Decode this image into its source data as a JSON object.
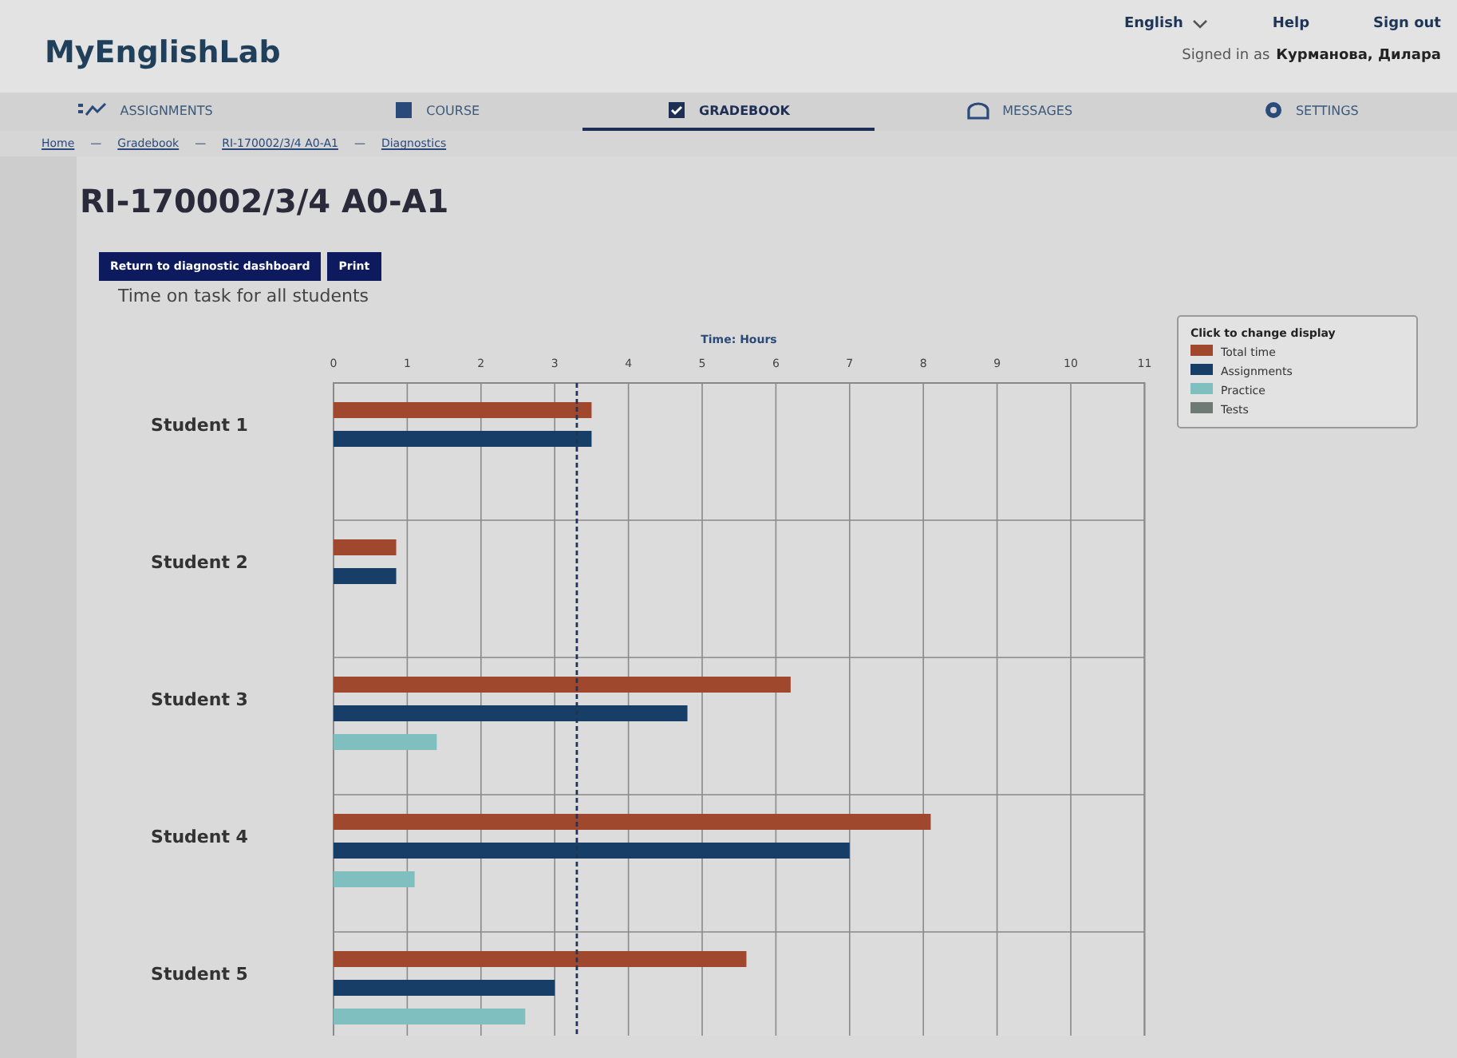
{
  "header": {
    "logo": "MyEnglishLab",
    "language": "English",
    "help": "Help",
    "sign_out": "Sign out",
    "signed_in_label": "Signed in as",
    "user": "Курманова, Дилара"
  },
  "tabs": [
    {
      "label": "ASSIGNMENTS",
      "selected": false
    },
    {
      "label": "COURSE",
      "selected": false
    },
    {
      "label": "GRADEBOOK",
      "selected": true
    },
    {
      "label": "MESSAGES",
      "selected": false
    },
    {
      "label": "SETTINGS",
      "selected": false
    }
  ],
  "breadcrumb": {
    "separator": "—",
    "items": [
      "Home",
      "Gradebook",
      "RI-170002/3/4 A0-A1",
      "Diagnostics"
    ]
  },
  "title": "RI-170002/3/4 A0-A1",
  "buttons": [
    "Return to diagnostic dashboard",
    "Print"
  ],
  "subtitle": "Time on task for all students",
  "chart": {
    "legend_title": "Click to change display",
    "chart_data": {
      "type": "bar",
      "orientation": "horizontal",
      "xlabel": "Time: Hours",
      "categories": [
        "Student 1",
        "Student 2",
        "Student 3",
        "Student 4",
        "Student 5"
      ],
      "xlim": [
        0,
        11
      ],
      "xticks": [
        0,
        1,
        2,
        3,
        4,
        5,
        6,
        7,
        8,
        9,
        10,
        11
      ],
      "series": [
        {
          "name": "Total time",
          "color": "#a0482e",
          "values": [
            3.5,
            0.85,
            6.2,
            8.1,
            5.6
          ]
        },
        {
          "name": "Assignments",
          "color": "#163e66",
          "values": [
            3.5,
            0.85,
            4.8,
            7.0,
            3.0
          ]
        },
        {
          "name": "Practice",
          "color": "#7fbfc0",
          "values": [
            null,
            null,
            1.4,
            1.1,
            2.6
          ]
        },
        {
          "name": "Tests",
          "color": "#6e7a73",
          "values": [
            null,
            null,
            null,
            null,
            null
          ]
        }
      ],
      "ref_lines": [
        {
          "axis": "x",
          "value": 3.3
        }
      ],
      "grid": true,
      "legend": true
    }
  }
}
